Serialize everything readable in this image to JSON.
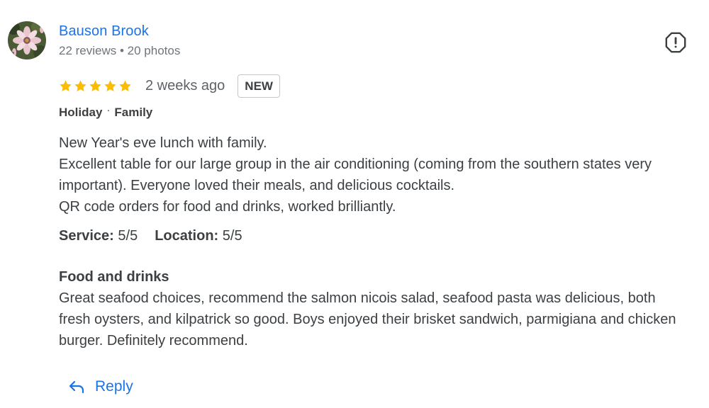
{
  "review": {
    "author": {
      "name": "Bauson Brook",
      "meta": "22 reviews • 20 photos",
      "avatar_icon": "flower-avatar"
    },
    "rating": {
      "stars": 5,
      "max_stars": 5
    },
    "time_ago": "2 weeks ago",
    "badge": "NEW",
    "tags": [
      "Holiday",
      "Family"
    ],
    "tag_separator": "·",
    "text_lines": [
      "New Year's eve lunch with family.",
      "Excellent table for our large group in the air conditioning (coming from the southern states very important). Everyone loved their meals, and delicious cocktails.",
      "QR code orders for food and drinks, worked brilliantly."
    ],
    "subratings": [
      {
        "label": "Service:",
        "value": "5/5"
      },
      {
        "label": "Location:",
        "value": "5/5"
      }
    ],
    "section": {
      "heading": "Food and drinks",
      "body": "Great seafood choices, recommend the salmon nicois salad, seafood pasta was delicious, both fresh oysters, and kilpatrick so good. Boys enjoyed their brisket sandwich, parmigiana and chicken burger. Definitely recommend."
    },
    "reply_label": "Reply"
  },
  "colors": {
    "link": "#1a73e8",
    "star": "#fbbc04",
    "text": "#3c4043",
    "muted": "#70757a"
  },
  "icons": {
    "report": "report-icon",
    "star": "star-icon",
    "reply": "reply-icon"
  }
}
